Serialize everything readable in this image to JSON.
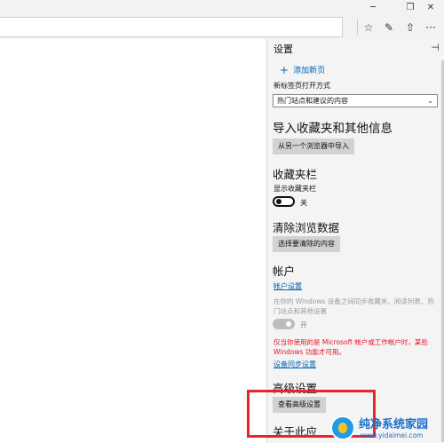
{
  "window": {
    "minimize_icon": "minimize-icon",
    "restore_icon": "restore-icon",
    "close_icon": "close-icon"
  },
  "toolbar": {
    "icons": [
      "reading-list-star-icon",
      "pen-note-icon",
      "share-icon",
      "more-icon"
    ],
    "more_glyph": "···"
  },
  "settings": {
    "title": "设置",
    "pin_glyph": "⊣",
    "add_new_tab": "添加新页",
    "new_tab_open_label": "新标签页打开方式",
    "new_tab_open_value": "热门站点和建议的内容",
    "import": {
      "title": "导入收藏夹和其他信息",
      "button": "从另一个浏览器中导入"
    },
    "favorites_bar": {
      "title": "收藏夹栏",
      "show_label": "显示收藏夹栏",
      "toggle_state": "关"
    },
    "clear_data": {
      "title": "清除浏览数据",
      "button": "选择要清除的内容"
    },
    "account": {
      "title": "帐户",
      "link": "帐户设置",
      "sync_desc": "在你的 Windows 设备之间同步收藏夹、阅读列表、热门站点和其他设置",
      "sync_state": "开",
      "warning": "仅当你使用的是 Microsoft 帐户或工作帐户时，某些 Windows 功能才可用。",
      "device_sync_link": "设备同步设置"
    },
    "advanced": {
      "title": "高级设置",
      "button": "查看高级设置"
    },
    "about": {
      "title": "关于此应"
    }
  },
  "watermark": {
    "name": "纯净系统家园",
    "url": "www.yidaimei.com"
  }
}
